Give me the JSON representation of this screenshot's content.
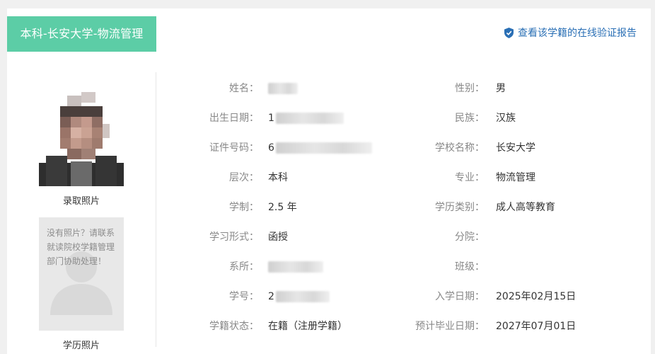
{
  "header": {
    "title": "本科-长安大学-物流管理",
    "verify_link": "查看该学籍的在线验证报告"
  },
  "photos": {
    "admission_caption": "录取照片",
    "education_caption": "学历照片",
    "no_photo_text": "没有照片？请联系就读院校学籍管理部门协助处理！"
  },
  "fields_left": [
    {
      "label": "姓名：",
      "value": ""
    },
    {
      "label": "出生日期：",
      "value": "1"
    },
    {
      "label": "证件号码：",
      "value": "6"
    },
    {
      "label": "层次：",
      "value": "本科"
    },
    {
      "label": "学制：",
      "value": "2.5 年"
    },
    {
      "label": "学习形式：",
      "value": "函授"
    },
    {
      "label": "系所：",
      "value": ""
    },
    {
      "label": "学号：",
      "value": "2"
    },
    {
      "label": "学籍状态：",
      "value": "在籍（注册学籍）"
    }
  ],
  "fields_right": [
    {
      "label": "性别：",
      "value": "男"
    },
    {
      "label": "民族：",
      "value": "汉族"
    },
    {
      "label": "学校名称：",
      "value": "长安大学"
    },
    {
      "label": "专业：",
      "value": "物流管理"
    },
    {
      "label": "学历类别：",
      "value": "成人高等教育"
    },
    {
      "label": "分院：",
      "value": ""
    },
    {
      "label": "班级：",
      "value": ""
    },
    {
      "label": "入学日期：",
      "value": "2025年02月15日"
    },
    {
      "label": "预计毕业日期：",
      "value": "2027年07月01日"
    }
  ],
  "colors": {
    "accent": "#5ccda6",
    "link": "#2a6fb5"
  },
  "icons": {
    "verify": "shield-check-icon",
    "placeholder": "person-silhouette-icon"
  }
}
